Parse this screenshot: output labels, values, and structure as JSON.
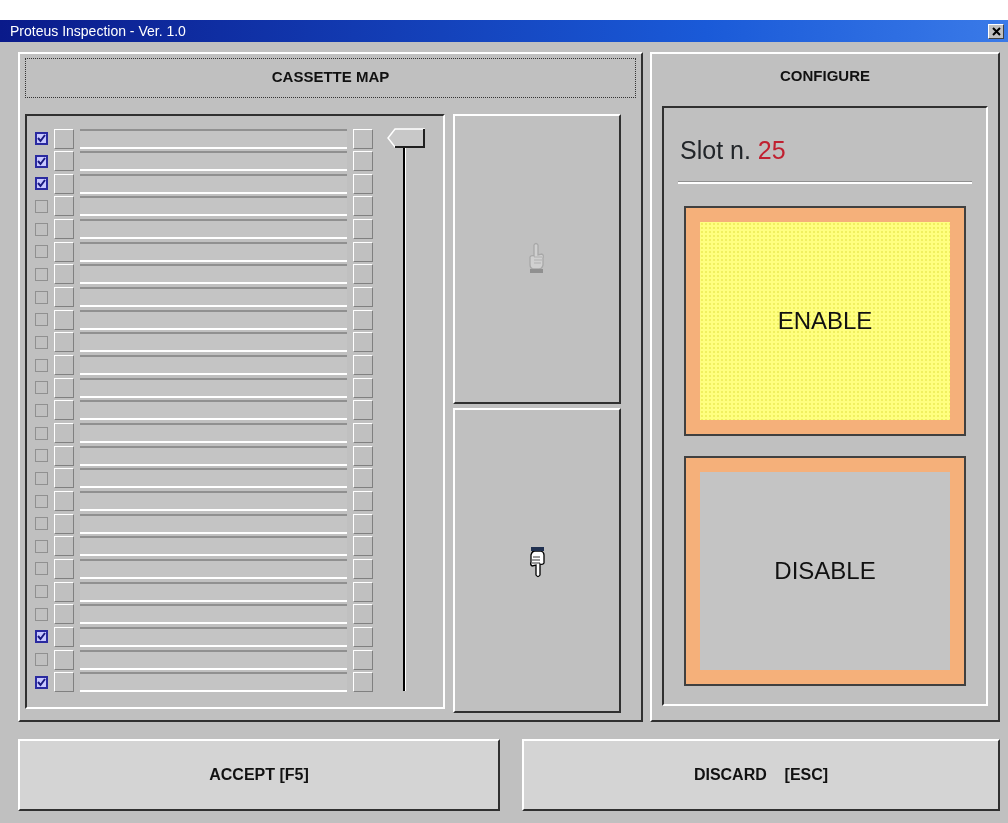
{
  "window": {
    "title": "Proteus Inspection - Ver. 1.0"
  },
  "cassette_map": {
    "title": "CASSETTE MAP",
    "slots": [
      {
        "checked": true
      },
      {
        "checked": true
      },
      {
        "checked": true
      },
      {
        "checked": false
      },
      {
        "checked": false
      },
      {
        "checked": false
      },
      {
        "checked": false
      },
      {
        "checked": false
      },
      {
        "checked": false
      },
      {
        "checked": false
      },
      {
        "checked": false
      },
      {
        "checked": false
      },
      {
        "checked": false
      },
      {
        "checked": false
      },
      {
        "checked": false
      },
      {
        "checked": false
      },
      {
        "checked": false
      },
      {
        "checked": false
      },
      {
        "checked": false
      },
      {
        "checked": false
      },
      {
        "checked": false
      },
      {
        "checked": false
      },
      {
        "checked": true
      },
      {
        "checked": false
      },
      {
        "checked": true
      }
    ],
    "slider": {
      "level": 0
    },
    "move_buttons": [
      {
        "kind": "up",
        "disabled": true
      },
      {
        "kind": "down",
        "disabled": false
      }
    ]
  },
  "configure": {
    "title": "CONFIGURE",
    "slot_label": "Slot n.",
    "slot_number": "25",
    "options": [
      {
        "label": "ENABLE",
        "selected": true
      },
      {
        "label": "DISABLE",
        "selected": false
      }
    ]
  },
  "buttons": [
    {
      "label": "ACCEPT [F5]"
    },
    {
      "label": "DISCARD    [ESC]"
    }
  ]
}
